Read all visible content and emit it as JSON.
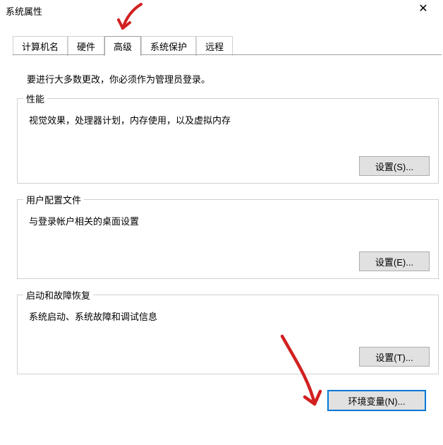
{
  "window": {
    "title": "系统属性"
  },
  "tabs": {
    "computer_name": "计算机名",
    "hardware": "硬件",
    "advanced": "高级",
    "system_protection": "系统保护",
    "remote": "远程"
  },
  "advanced_tab": {
    "intro": "要进行大多数更改，你必须作为管理员登录。",
    "performance": {
      "title": "性能",
      "desc": "视觉效果，处理器计划，内存使用，以及虚拟内存",
      "settings_label": "设置(S)..."
    },
    "user_profiles": {
      "title": "用户配置文件",
      "desc": "与登录帐户相关的桌面设置",
      "settings_label": "设置(E)..."
    },
    "startup_recovery": {
      "title": "启动和故障恢复",
      "desc": "系统启动、系统故障和调试信息",
      "settings_label": "设置(T)..."
    },
    "env_vars_label": "环境变量(N)..."
  }
}
